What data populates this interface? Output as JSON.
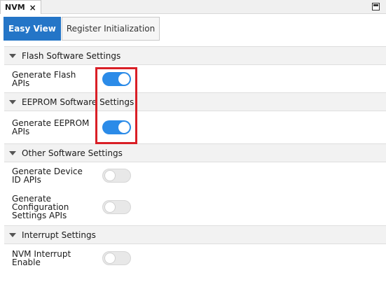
{
  "doc_tab": {
    "label": "NVM",
    "close": "×"
  },
  "view_tabs": [
    {
      "label": "Easy View",
      "active": true
    },
    {
      "label": "Register Initialization",
      "active": false
    }
  ],
  "sections": [
    {
      "title": "Flash Software Settings",
      "rows": [
        {
          "label": "Generate Flash APIs",
          "on": true
        }
      ]
    },
    {
      "title": "EEPROM Software Settings",
      "rows": [
        {
          "label": "Generate EEPROM APIs",
          "on": true
        }
      ]
    },
    {
      "title": "Other Software Settings",
      "rows": [
        {
          "label": "Generate Device ID APIs",
          "on": false
        },
        {
          "label": "Generate Configuration Settings APIs",
          "on": false
        }
      ]
    },
    {
      "title": "Interrupt Settings",
      "rows": [
        {
          "label": "NVM Interrupt Enable",
          "on": false
        }
      ]
    }
  ],
  "colors": {
    "accent": "#2475c7",
    "toggle_on": "#2b8be8",
    "highlight": "#d91f26"
  }
}
